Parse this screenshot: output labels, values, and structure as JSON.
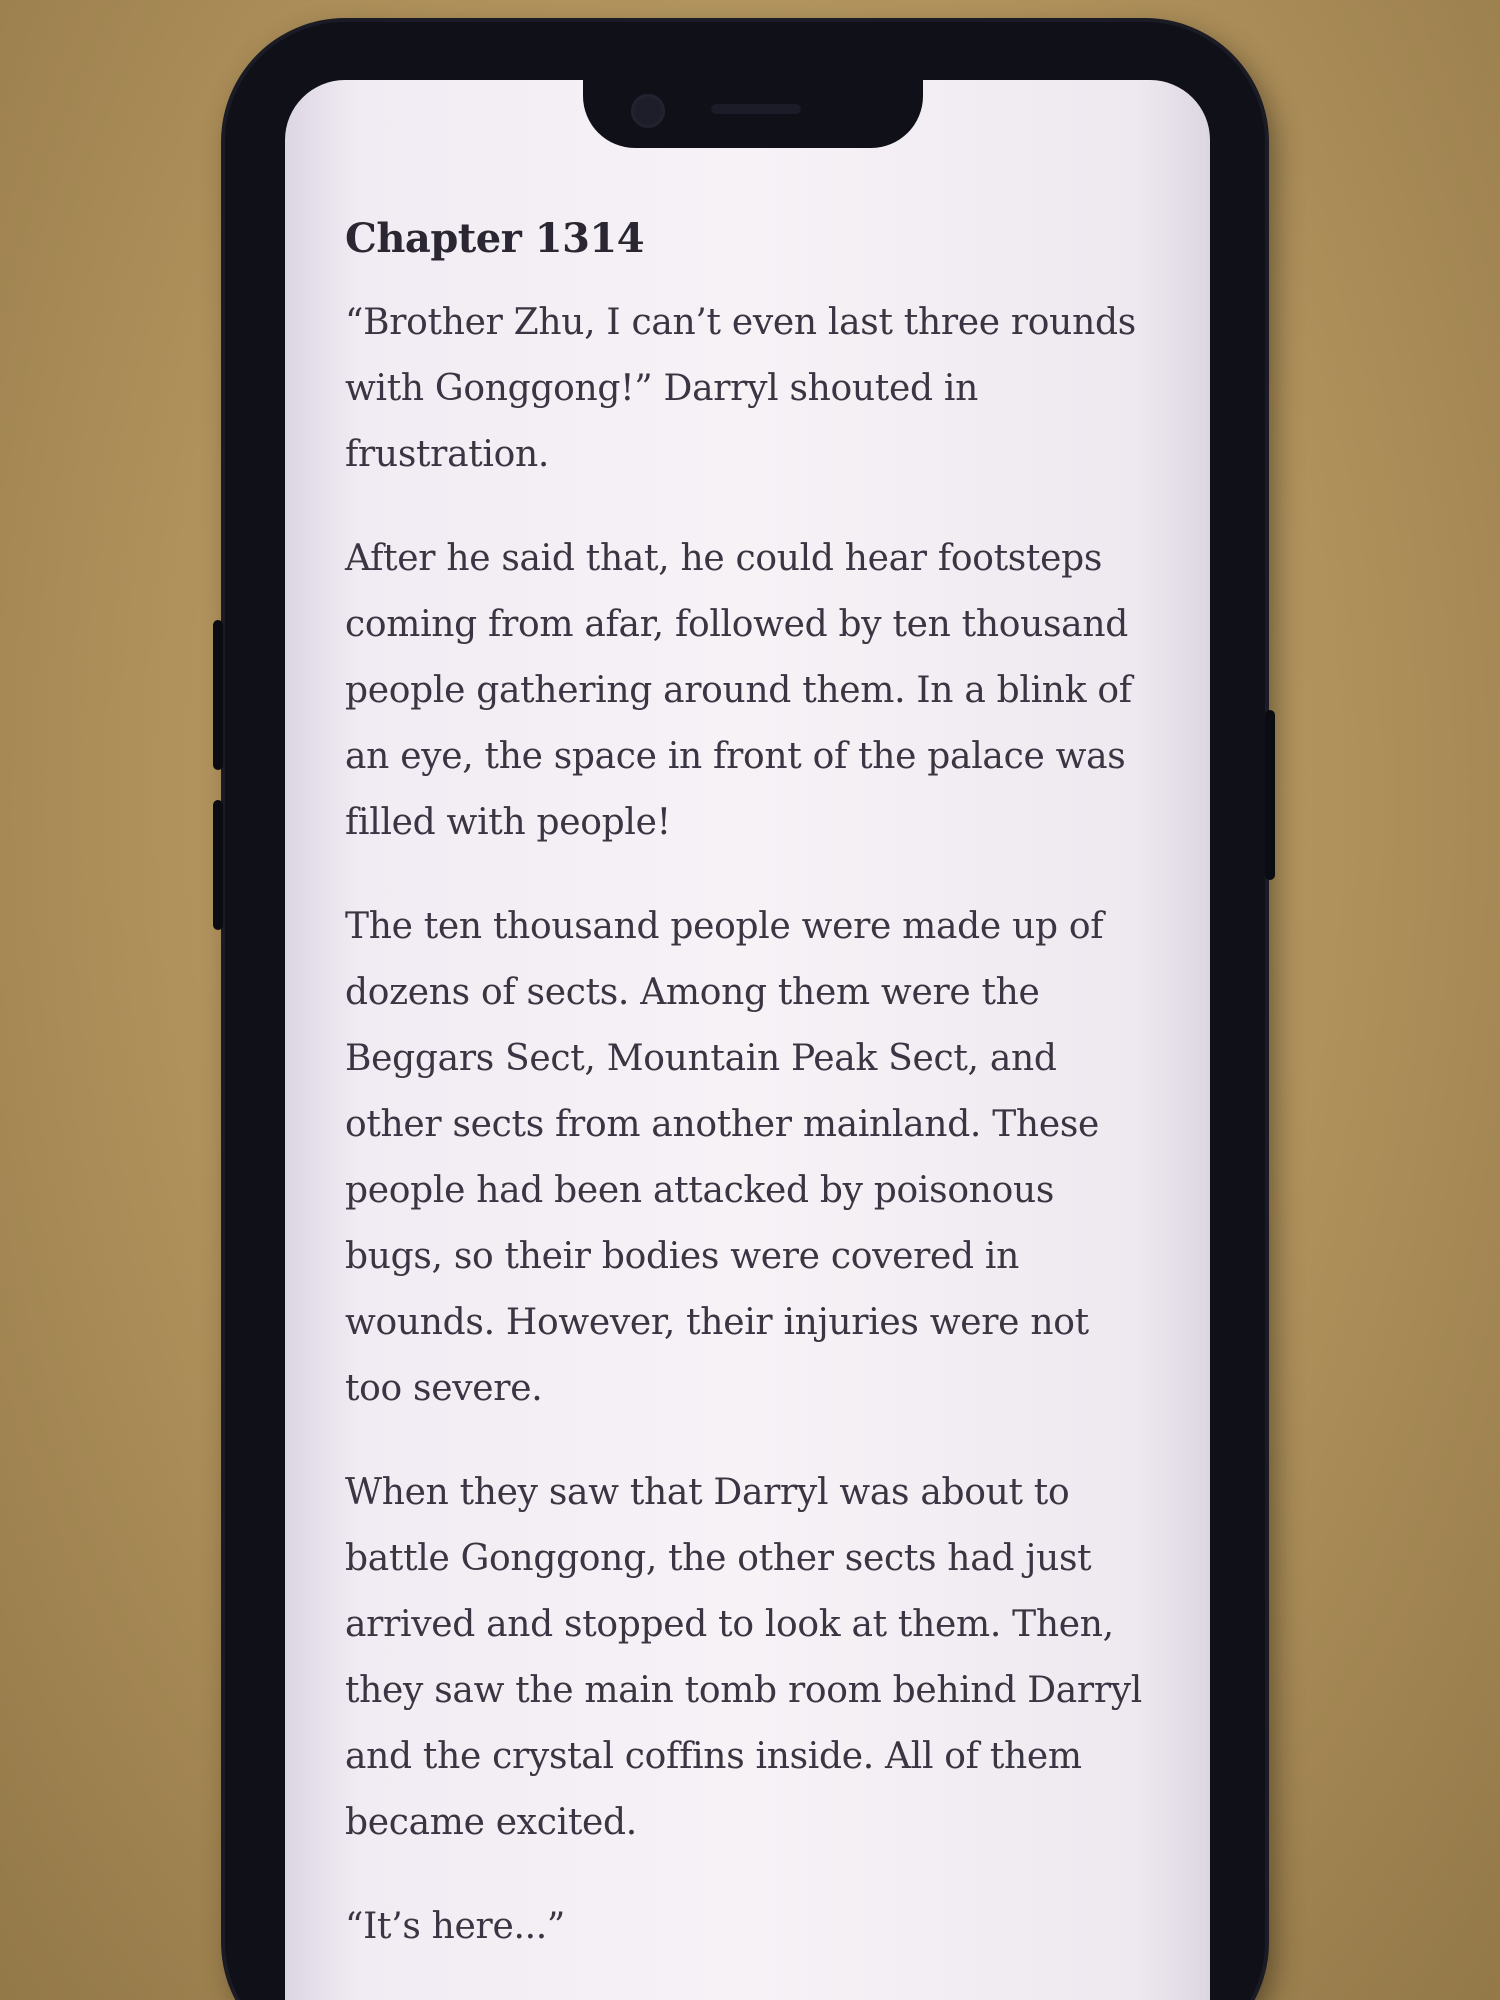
{
  "reader": {
    "chapter_title": "Chapter 1314",
    "paragraphs": [
      "“Brother Zhu, I can’t even last three rounds with Gonggong!” Darryl shouted in frustration.",
      "After he said that, he could hear footsteps coming from afar, followed by ten thousand people gathering around them. In a blink of an eye, the space in front of the palace was filled with people!",
      "The ten thousand people were made up of dozens of sects. Among them were the Beggars Sect, Mountain Peak Sect, and other sects from another mainland. These people had been attacked by poisonous bugs, so their bodies were covered in wounds. However, their injuries were not too severe.",
      "When they saw that Darryl was about to battle Gonggong, the other sects had just arrived and stopped to look at them. Then, they saw the main tomb room behind Darryl and the crystal coffins inside. All of them became excited.",
      "“It’s here...”"
    ]
  },
  "colors": {
    "page_background": "#f4f0f5",
    "text": "#3a3542",
    "phone_body": "#101018"
  }
}
